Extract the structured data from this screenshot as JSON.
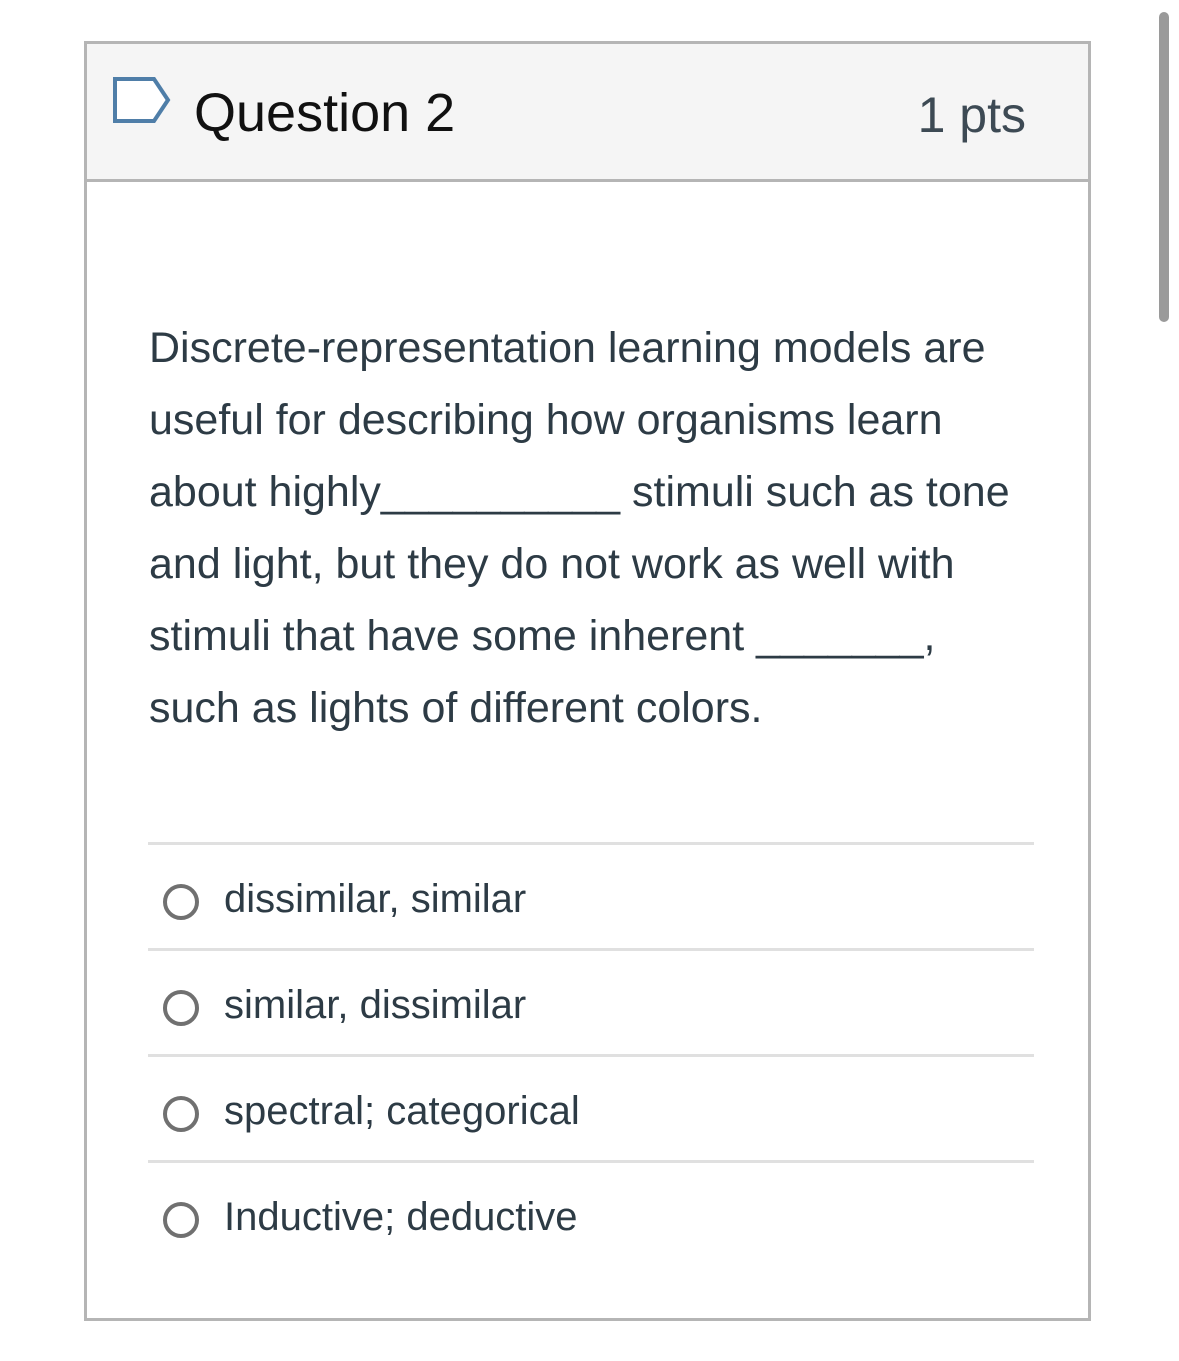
{
  "question": {
    "title": "Question 2",
    "points": "1 pts",
    "text": "Discrete-representation learning models are useful for describing how organisms learn about highly__________ stimuli such as tone and light, but they do not work as well with stimuli that have some inherent _______, such as lights of different colors.",
    "answers": [
      {
        "label": "dissimilar, similar"
      },
      {
        "label": "similar, dissimilar"
      },
      {
        "label": "spectral; categorical"
      },
      {
        "label": "Inductive; deductive"
      }
    ]
  },
  "icons": {
    "flag": "flag-icon",
    "radio": "radio-unchecked-icon"
  },
  "colors": {
    "flag_stroke": "#4f7ea8",
    "border": "#b5b5b5",
    "header_bg": "#f5f5f5",
    "text": "#2d3b45"
  }
}
